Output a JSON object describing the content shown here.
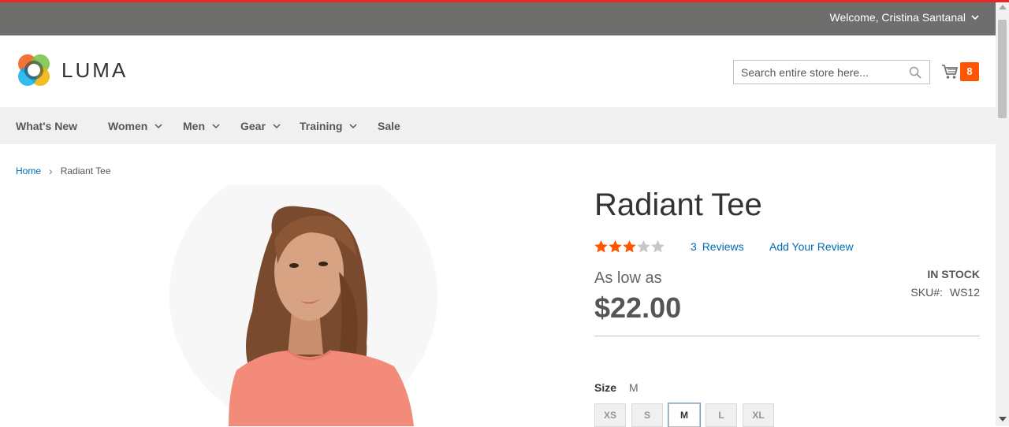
{
  "panel": {
    "welcome_text": "Welcome, Cristina Santanal"
  },
  "header": {
    "logo_text": "LUMA",
    "search_placeholder": "Search entire store here...",
    "cart_count": "8"
  },
  "nav": {
    "items": [
      {
        "label": "What's New"
      },
      {
        "label": "Women"
      },
      {
        "label": "Men"
      },
      {
        "label": "Gear"
      },
      {
        "label": "Training"
      },
      {
        "label": "Sale"
      }
    ]
  },
  "breadcrumb": {
    "home": "Home",
    "separator": "›",
    "current": "Radiant Tee"
  },
  "product": {
    "title": "Radiant Tee",
    "rating_stars": 3,
    "rating_max": 5,
    "reviews_count": "3",
    "reviews_label": "Reviews",
    "add_review": "Add Your Review",
    "as_low_as": "As low as",
    "price": "$22.00",
    "stock": "IN STOCK",
    "sku_label": "SKU#:",
    "sku_value": "WS12",
    "size_label": "Size",
    "size_selected": "M",
    "sizes": [
      "XS",
      "S",
      "M",
      "L",
      "XL"
    ]
  },
  "colors": {
    "accent_red": "#e02b27",
    "panel_bg": "#6e6e6c",
    "link_blue": "#006bb4",
    "cart_badge": "#ff5501",
    "star_filled": "#ff5501",
    "star_empty": "#c7c7c7"
  },
  "icons": [
    "chevron-down-icon",
    "search-icon",
    "cart-icon",
    "star-icon",
    "logo-icon"
  ]
}
